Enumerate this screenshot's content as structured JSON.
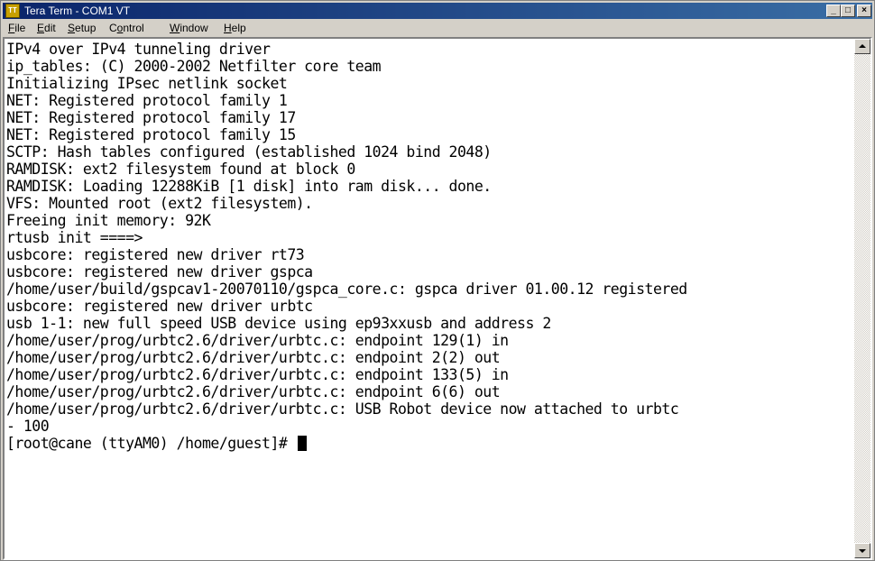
{
  "window": {
    "title": "Tera Term - COM1 VT",
    "icon": "teraterm-app-icon",
    "icon_label": "TT",
    "controls": {
      "minimize": "_",
      "maximize": "□",
      "close": "×"
    }
  },
  "menu": {
    "items": [
      {
        "label": "File",
        "ul": "F",
        "rest": "ile"
      },
      {
        "label": "Edit",
        "ul": "E",
        "rest": "dit"
      },
      {
        "label": "Setup",
        "ul": "S",
        "rest": "etup"
      },
      {
        "label": "Control",
        "pre": "C",
        "ul": "o",
        "rest": "ntrol"
      },
      {
        "label": "Window",
        "ul": "W",
        "rest": "indow"
      },
      {
        "label": "Help",
        "ul": "H",
        "rest": "elp"
      }
    ]
  },
  "terminal": {
    "lines": [
      "IPv4 over IPv4 tunneling driver",
      "ip_tables: (C) 2000-2002 Netfilter core team",
      "Initializing IPsec netlink socket",
      "NET: Registered protocol family 1",
      "NET: Registered protocol family 17",
      "NET: Registered protocol family 15",
      "SCTP: Hash tables configured (established 1024 bind 2048)",
      "RAMDISK: ext2 filesystem found at block 0",
      "RAMDISK: Loading 12288KiB [1 disk] into ram disk... done.",
      "VFS: Mounted root (ext2 filesystem).",
      "Freeing init memory: 92K",
      "rtusb init ====>",
      "usbcore: registered new driver rt73",
      "usbcore: registered new driver gspca",
      "/home/user/build/gspcav1-20070110/gspca_core.c: gspca driver 01.00.12 registered",
      "usbcore: registered new driver urbtc",
      "usb 1-1: new full speed USB device using ep93xxusb and address 2",
      "/home/user/prog/urbtc2.6/driver/urbtc.c: endpoint 129(1) in",
      "/home/user/prog/urbtc2.6/driver/urbtc.c: endpoint 2(2) out",
      "/home/user/prog/urbtc2.6/driver/urbtc.c: endpoint 133(5) in",
      "/home/user/prog/urbtc2.6/driver/urbtc.c: endpoint 6(6) out",
      "/home/user/prog/urbtc2.6/driver/urbtc.c: USB Robot device now attached to urbtc",
      "- 100"
    ],
    "prompt": "[root@cane (ttyAM0) /home/guest]# "
  },
  "colors": {
    "titlebar_start": "#0a246a",
    "titlebar_end": "#3a6ea5",
    "terminal_bg": "#ffffff",
    "terminal_fg": "#000000"
  }
}
